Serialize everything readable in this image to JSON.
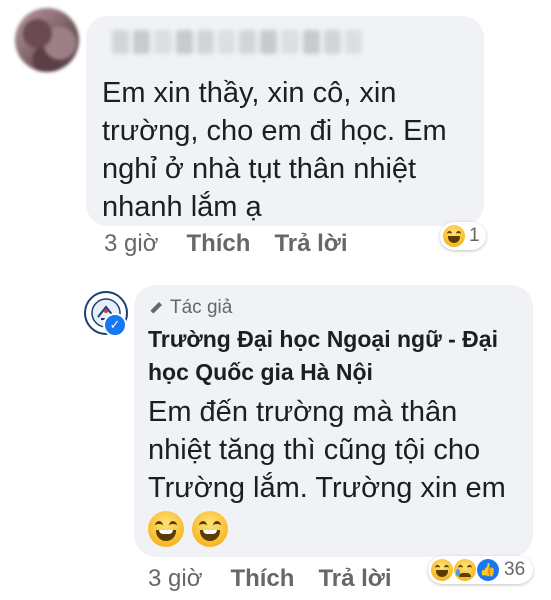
{
  "comment1": {
    "text": "Em xin thầy, xin cô, xin trường, cho em đi học. Em nghỉ ở nhà tụt thân nhiệt nhanh lắm ạ",
    "time": "3 giờ",
    "like_label": "Thích",
    "reply_label": "Trả lời",
    "reactions": {
      "icons": [
        "haha-icon"
      ],
      "count": "1"
    }
  },
  "comment2": {
    "author_tag": "Tác giả",
    "page_name": "Trường Đại học Ngoại ngữ - Đại học Quốc gia Hà Nội",
    "text": "Em đến trường mà thân nhiệt tăng thì cũng tội cho Trường lắm. Trường xin em",
    "emojis": [
      "grin-emoji",
      "grin-emoji"
    ],
    "time": "3 giờ",
    "like_label": "Thích",
    "reply_label": "Trả lời",
    "reactions": {
      "icons": [
        "haha-icon",
        "sad-icon",
        "like-icon"
      ],
      "count": "36"
    }
  },
  "colors": {
    "bubble_bg": "#f0f2f5",
    "text": "#1c1e21",
    "meta": "#65676b",
    "facebook_blue": "#1877f2"
  }
}
